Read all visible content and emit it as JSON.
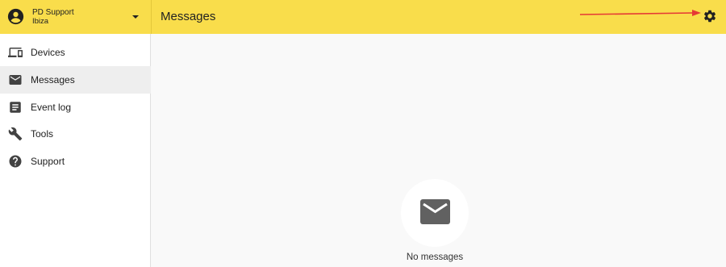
{
  "account": {
    "name": "PD Support",
    "location": "Ibiza"
  },
  "header": {
    "title": "Messages",
    "settings_icon": "gear-icon"
  },
  "sidebar": {
    "items": [
      {
        "label": "Devices",
        "icon": "devices-icon",
        "active": false
      },
      {
        "label": "Messages",
        "icon": "mail-icon",
        "active": true
      },
      {
        "label": "Event log",
        "icon": "event-log-icon",
        "active": false
      },
      {
        "label": "Tools",
        "icon": "wrench-icon",
        "active": false
      },
      {
        "label": "Support",
        "icon": "help-icon",
        "active": false
      }
    ]
  },
  "main": {
    "empty_state_text": "No messages",
    "empty_state_icon": "mail-icon"
  },
  "colors": {
    "topbar": "#f9dd4b",
    "active_item": "#eeeeee",
    "icon": "#424242",
    "annotation_arrow": "#e53935"
  }
}
